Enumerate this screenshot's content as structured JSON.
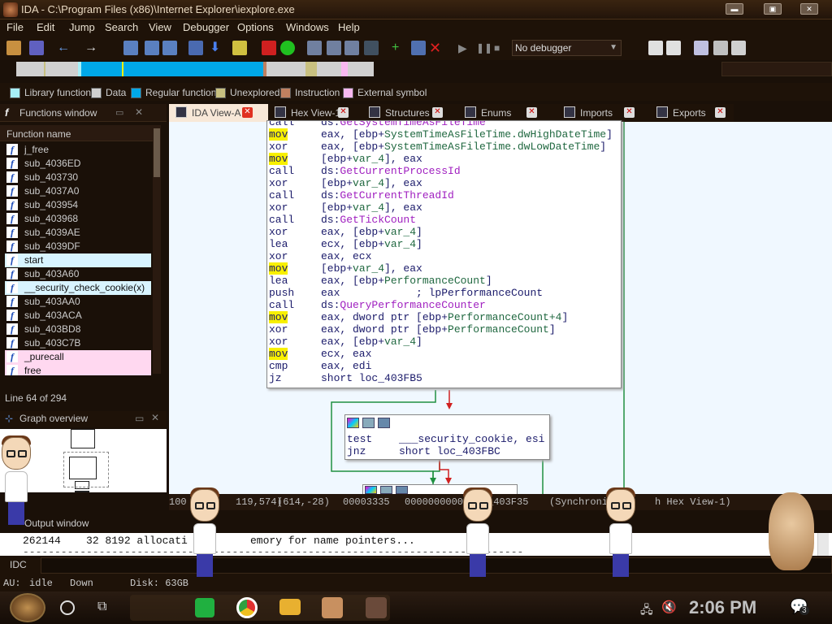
{
  "window": {
    "title": "IDA - C:\\Program Files (x86)\\Internet Explorer\\iexplore.exe"
  },
  "menu": [
    "File",
    "Edit",
    "Jump",
    "Search",
    "View",
    "Debugger",
    "Options",
    "Windows",
    "Help"
  ],
  "toolbar": {
    "debugger_select": "No debugger"
  },
  "legend": [
    {
      "label": "Library function",
      "color": "#a8f0f8"
    },
    {
      "label": "Data",
      "color": "#d0d0d0"
    },
    {
      "label": "Regular function",
      "color": "#00a8e8"
    },
    {
      "label": "Unexplored",
      "color": "#c8c080"
    },
    {
      "label": "Instruction",
      "color": "#c08060"
    },
    {
      "label": "External symbol",
      "color": "#f8b8f0"
    }
  ],
  "functions_window": {
    "title": "Functions window",
    "column": "Function name",
    "items": [
      {
        "name": "j_free",
        "style": ""
      },
      {
        "name": "sub_4036ED",
        "style": ""
      },
      {
        "name": "sub_403730",
        "style": ""
      },
      {
        "name": "sub_4037A0",
        "style": ""
      },
      {
        "name": "sub_403954",
        "style": ""
      },
      {
        "name": "sub_403968",
        "style": ""
      },
      {
        "name": "sub_4039AE",
        "style": ""
      },
      {
        "name": "sub_4039DF",
        "style": ""
      },
      {
        "name": "start",
        "style": "sel"
      },
      {
        "name": "sub_403A60",
        "style": ""
      },
      {
        "name": "__security_check_cookie(x)",
        "style": "sel"
      },
      {
        "name": "sub_403AA0",
        "style": ""
      },
      {
        "name": "sub_403ACA",
        "style": ""
      },
      {
        "name": "sub_403BD8",
        "style": ""
      },
      {
        "name": "sub_403C7B",
        "style": ""
      },
      {
        "name": "_purecall",
        "style": "pink"
      },
      {
        "name": "free",
        "style": "pink"
      }
    ],
    "line_info": "Line 64 of 294"
  },
  "graph_overview": {
    "title": "Graph overview"
  },
  "tabs": [
    {
      "label": "IDA View-A",
      "active": true
    },
    {
      "label": "Hex View-1",
      "active": false
    },
    {
      "label": "Structures",
      "active": false
    },
    {
      "label": "Enums",
      "active": false
    },
    {
      "label": "Imports",
      "active": false
    },
    {
      "label": "Exports",
      "active": false
    }
  ],
  "code": [
    {
      "mn": "call",
      "op": [
        {
          "t": "ds:"
        },
        {
          "t": "GetSystemTimeAsFileTime",
          "c": "s"
        }
      ],
      "hl": false
    },
    {
      "mn": "mov",
      "op": [
        {
          "t": "eax, [ebp+"
        },
        {
          "t": "SystemTimeAsFileTime.dwHighDateTime",
          "c": "g"
        },
        {
          "t": "]"
        }
      ],
      "hl": true
    },
    {
      "mn": "xor",
      "op": [
        {
          "t": "eax, [ebp+"
        },
        {
          "t": "SystemTimeAsFileTime.dwLowDateTime",
          "c": "g"
        },
        {
          "t": "]"
        }
      ],
      "hl": false
    },
    {
      "mn": "mov",
      "op": [
        {
          "t": "[ebp+"
        },
        {
          "t": "var_4",
          "c": "g"
        },
        {
          "t": "], eax"
        }
      ],
      "hl": true
    },
    {
      "mn": "call",
      "op": [
        {
          "t": "ds:"
        },
        {
          "t": "GetCurrentProcessId",
          "c": "s"
        }
      ],
      "hl": false
    },
    {
      "mn": "xor",
      "op": [
        {
          "t": "[ebp+"
        },
        {
          "t": "var_4",
          "c": "g"
        },
        {
          "t": "], eax"
        }
      ],
      "hl": false
    },
    {
      "mn": "call",
      "op": [
        {
          "t": "ds:"
        },
        {
          "t": "GetCurrentThreadId",
          "c": "s"
        }
      ],
      "hl": false
    },
    {
      "mn": "xor",
      "op": [
        {
          "t": "[ebp+"
        },
        {
          "t": "var_4",
          "c": "g"
        },
        {
          "t": "], eax"
        }
      ],
      "hl": false
    },
    {
      "mn": "call",
      "op": [
        {
          "t": "ds:"
        },
        {
          "t": "GetTickCount",
          "c": "s"
        }
      ],
      "hl": false
    },
    {
      "mn": "xor",
      "op": [
        {
          "t": "eax, [ebp+"
        },
        {
          "t": "var_4",
          "c": "g"
        },
        {
          "t": "]"
        }
      ],
      "hl": false
    },
    {
      "mn": "lea",
      "op": [
        {
          "t": "ecx, [ebp+"
        },
        {
          "t": "var_4",
          "c": "g"
        },
        {
          "t": "]"
        }
      ],
      "hl": false
    },
    {
      "mn": "xor",
      "op": [
        {
          "t": "eax, ecx"
        }
      ],
      "hl": false
    },
    {
      "mn": "mov",
      "op": [
        {
          "t": "[ebp+"
        },
        {
          "t": "var_4",
          "c": "g"
        },
        {
          "t": "], eax"
        }
      ],
      "hl": true
    },
    {
      "mn": "lea",
      "op": [
        {
          "t": "eax, [ebp+"
        },
        {
          "t": "PerformanceCount",
          "c": "g"
        },
        {
          "t": "]"
        }
      ],
      "hl": false
    },
    {
      "mn": "push",
      "op": [
        {
          "t": "eax            ; lpPerformanceCount"
        }
      ],
      "hl": false
    },
    {
      "mn": "call",
      "op": [
        {
          "t": "ds:"
        },
        {
          "t": "QueryPerformanceCounter",
          "c": "s"
        }
      ],
      "hl": false
    },
    {
      "mn": "mov",
      "op": [
        {
          "t": "eax, dword ptr [ebp+"
        },
        {
          "t": "PerformanceCount+4",
          "c": "g"
        },
        {
          "t": "]"
        }
      ],
      "hl": true
    },
    {
      "mn": "xor",
      "op": [
        {
          "t": "eax, dword ptr [ebp+"
        },
        {
          "t": "PerformanceCount",
          "c": "g"
        },
        {
          "t": "]"
        }
      ],
      "hl": false
    },
    {
      "mn": "xor",
      "op": [
        {
          "t": "eax, [ebp+"
        },
        {
          "t": "var_4",
          "c": "g"
        },
        {
          "t": "]"
        }
      ],
      "hl": false
    },
    {
      "mn": "mov",
      "op": [
        {
          "t": "ecx, eax"
        }
      ],
      "hl": true
    },
    {
      "mn": "cmp",
      "op": [
        {
          "t": "eax, edi"
        }
      ],
      "hl": false
    },
    {
      "mn": "jz",
      "op": [
        {
          "t": "short loc_403FB5"
        }
      ],
      "hl": false
    }
  ],
  "code2": [
    {
      "mn": "test",
      "op": "___security_cookie, esi"
    },
    {
      "mn": "jnz",
      "op": "short loc_403FBC"
    }
  ],
  "status": {
    "zoom": "100",
    "coord": "119,574)",
    "pos": "(614,-28)",
    "offset": "00003335",
    "addr": "00000000004035",
    "func": "_403F35",
    "sync": "(Synchroni",
    "sync2": "h Hex View-1)"
  },
  "output": {
    "title": "Output window",
    "line1": "262144    32 8192 allocati",
    "line1b": "emory for name pointers...",
    "line2": "-------------------------------------------------------------------------------"
  },
  "idc_label": "IDC",
  "statusbar": {
    "state_label": "AU:",
    "state": "idle",
    "direction": "Down",
    "disk": "Disk: 63GB"
  },
  "taskbar": {
    "time": "2:06 PM",
    "notif_count": "3"
  }
}
